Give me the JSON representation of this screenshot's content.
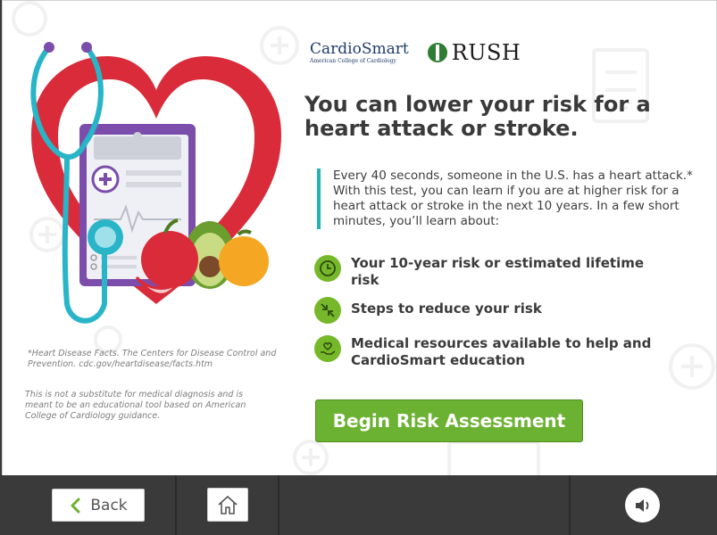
{
  "logos": {
    "cardiosmart_name": "CardioSmart",
    "cardiosmart_sub": "American College of Cardiology",
    "rush_name": "RUSH"
  },
  "headline": "You can lower your risk for a heart attack or stroke.",
  "intro": "Every 40 seconds, someone in the U.S. has a heart attack.* With this test, you can learn if you are at higher risk for a heart attack or stroke in the next 10 years. In a few short minutes, you’ll learn about:",
  "features": [
    {
      "icon": "clock-icon",
      "label": "Your 10-year risk or estimated lifetime risk"
    },
    {
      "icon": "arrows-in-icon",
      "label": "Steps to reduce your risk"
    },
    {
      "icon": "heart-hand-icon",
      "label": "Medical resources available to help and CardioSmart education"
    }
  ],
  "cta_label": "Begin Risk Assessment",
  "footnote": "*Heart Disease Facts. The Centers for Disease Control and Prevention. cdc.gov/heartdisease/facts.htm",
  "disclaimer": "This is not a substitute for medical diagnosis and is meant to be an educational tool based on American College of Cardiology guidance.",
  "nav": {
    "back_label": "Back"
  },
  "colors": {
    "accent_green": "#6cb232",
    "teal_bar": "#22b3b3",
    "heart_red": "#d92b3a",
    "clipboard_purple": "#7c4dab"
  }
}
